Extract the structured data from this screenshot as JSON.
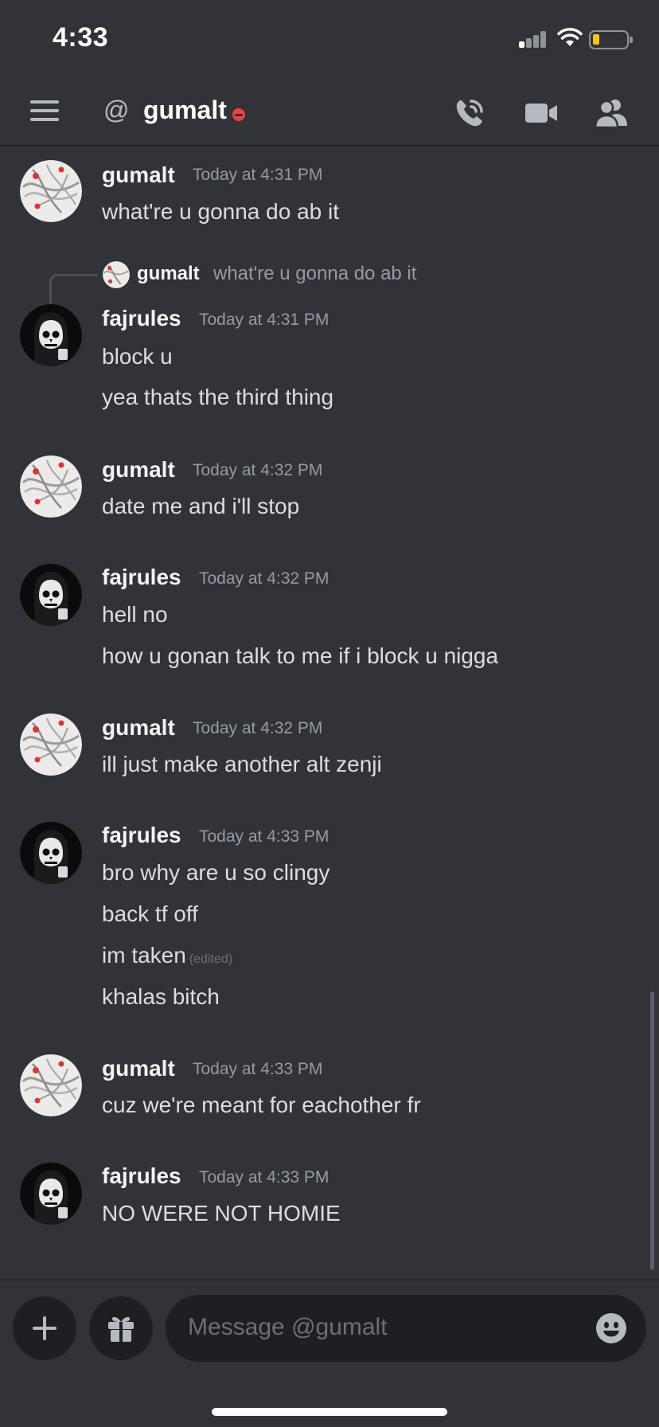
{
  "status_bar": {
    "time": "4:33"
  },
  "header": {
    "at_symbol": "@",
    "channel_name": "gumalt"
  },
  "reply": {
    "author": "gumalt",
    "text": "what're u gonna do ab it"
  },
  "messages": [
    {
      "author": "gumalt",
      "timestamp": "Today at 4:31 PM",
      "lines": [
        "what're u gonna do ab it"
      ]
    },
    {
      "author": "fajrules",
      "timestamp": "Today at 4:31 PM",
      "lines": [
        "block u",
        "yea thats the third thing"
      ]
    },
    {
      "author": "gumalt",
      "timestamp": "Today at 4:32 PM",
      "lines": [
        "date me and i'll stop"
      ]
    },
    {
      "author": "fajrules",
      "timestamp": "Today at 4:32 PM",
      "lines": [
        "hell no",
        "how u gonan talk to me if i block u nigga"
      ]
    },
    {
      "author": "gumalt",
      "timestamp": "Today at 4:32 PM",
      "lines": [
        "ill just make another alt zenji"
      ]
    },
    {
      "author": "fajrules",
      "timestamp": "Today at 4:33 PM",
      "lines": [
        "bro why are u so clingy",
        "back tf off",
        "im taken",
        "khalas bitch"
      ],
      "edited_label": "(edited)"
    },
    {
      "author": "gumalt",
      "timestamp": "Today at 4:33 PM",
      "lines": [
        "cuz we're meant for eachother fr"
      ]
    },
    {
      "author": "fajrules",
      "timestamp": "Today at 4:33 PM",
      "lines": [
        "NO WERE NOT HOMIE"
      ]
    }
  ],
  "composer": {
    "placeholder": "Message @gumalt"
  },
  "icons": {
    "menu": "hamburger-icon",
    "at": "at-icon",
    "status": "do-not-disturb-icon",
    "call": "phone-call-icon",
    "video": "video-camera-icon",
    "members": "members-icon",
    "add": "plus-icon",
    "gift": "gift-icon",
    "emoji": "emoji-icon"
  },
  "colors": {
    "background": "#313338",
    "input": "#1e1f22",
    "dnd": "#f23f43",
    "muted": "#949ba4"
  }
}
